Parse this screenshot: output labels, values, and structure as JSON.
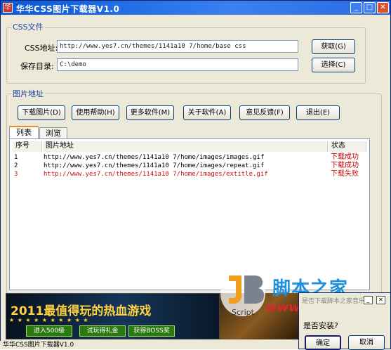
{
  "window": {
    "title": "华华CSS图片下载器V1.0",
    "icon_text": "华"
  },
  "css_group": {
    "label": "CSS文件",
    "url_label": "CSS地址:",
    "url_value": "http://www.yes7.cn/themes/1141a10 7/home/base css",
    "fetch_button": "获取(G)",
    "dir_label": "保存目录:",
    "dir_value": "C:\\demo",
    "browse_button": "选择(C)"
  },
  "img_group": {
    "label": "图片地址"
  },
  "toolbar": {
    "download": "下载图片(D)",
    "help": "使用帮助(H)",
    "more": "更多软件(M)",
    "about": "关于软件(A)",
    "feedback": "意见反馈(F)",
    "exit": "退出(E)"
  },
  "tabs": {
    "list": "列表",
    "preview": "浏览"
  },
  "table": {
    "headers": [
      "序号",
      "图片地址",
      "状态"
    ],
    "rows": [
      {
        "index": "1",
        "url": "http://www.yes7.cn/themes/1141a10 7/home/images/images.gif",
        "status": "下载成功"
      },
      {
        "index": "2",
        "url": "http://www.yes7.cn/themes/1141a10 7/home/images/repeat.gif",
        "status": "下载成功"
      },
      {
        "index": "3",
        "url": "http://www.yes7.cn/themes/1141a10 7/home/images/extitle.gif",
        "status": "下载失败"
      }
    ]
  },
  "banner": {
    "title": "2011最值得玩的热血游戏",
    "btn1": "进入500级",
    "btn2": "试玩得礼金",
    "btn3": "获得BOSS奖"
  },
  "dialog": {
    "text": "是否安装?",
    "line1": "是否下载脚本之家音乐盒,",
    "ok": "确定",
    "cancel": "取消"
  },
  "watermark": {
    "logo_letters": "JB",
    "script": "Script",
    "text": "脚本之家",
    "url": "www.jb51.net"
  },
  "statusbar": {
    "text": "华华CSS图片下载器V1.0"
  },
  "colors": {
    "fail": "#d01010",
    "ok": "#c00000"
  }
}
